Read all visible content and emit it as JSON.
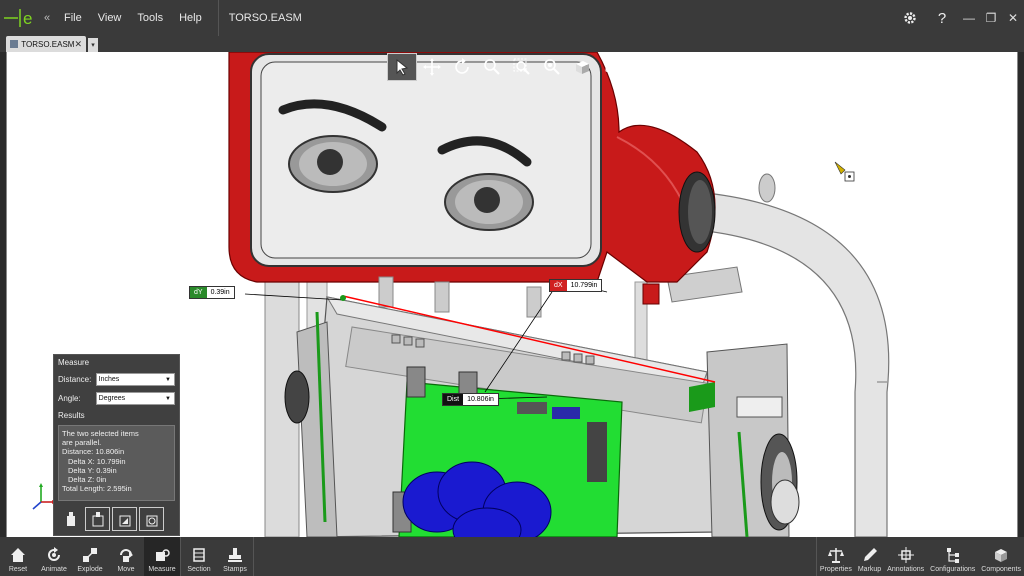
{
  "menu": [
    "File",
    "View",
    "Tools",
    "Help"
  ],
  "document_title": "TORSO.EASM",
  "tab": {
    "label": "TORSO.EASM",
    "close": "✕",
    "dropdown": "▾"
  },
  "callouts": {
    "dy": {
      "key": "dY",
      "value": "0.39in"
    },
    "dx": {
      "key": "dX",
      "value": "10.799in"
    },
    "dist": {
      "key": "Dist",
      "value": "10.806in"
    }
  },
  "measure": {
    "title": "Measure",
    "distance_label": "Distance:",
    "distance_value": "Inches",
    "angle_label": "Angle:",
    "angle_value": "Degrees",
    "results_label": "Results",
    "results": {
      "line1": "The two selected items",
      "line2": "are parallel.",
      "distance": "Distance: 10.806in",
      "delta_x": "Delta X: 10.799in",
      "delta_y": "Delta Y: 0.39in",
      "delta_z": "Delta Z: 0in",
      "total": "Total Length: 2.595in"
    }
  },
  "bottom_left": [
    "Reset",
    "Animate",
    "Explode",
    "Move",
    "Measure",
    "Section",
    "Stamps"
  ],
  "bottom_right": [
    "Properties",
    "Markup",
    "Annotations",
    "Configurations",
    "Components"
  ],
  "colors": {
    "accent_red": "#cc1a1a",
    "board_green": "#22dd33",
    "capacitor_blue": "#1a1ad0",
    "ui_dark": "#3a3a3a",
    "dy_label": "#2a8a2a",
    "dx_label": "#d02020"
  }
}
